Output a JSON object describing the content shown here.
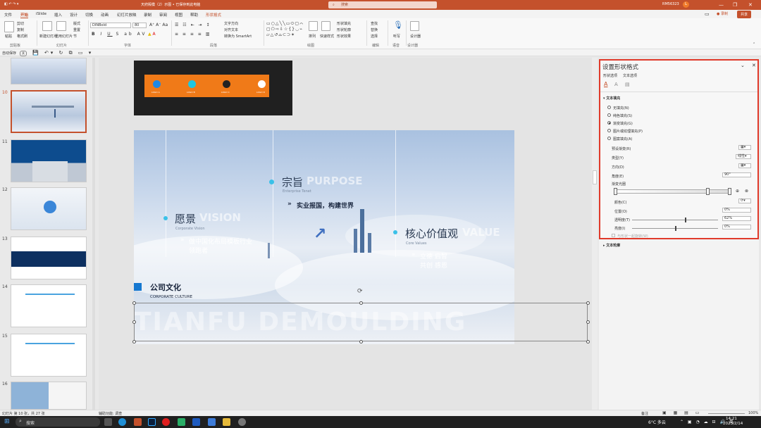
{
  "titlebar": {
    "document_title": "天府殿模（2）示图 • 已保存到此电脑",
    "search_placeholder": "搜索",
    "user_name": "RM56323",
    "avatar_letter": "L",
    "min": "—",
    "restore": "❐",
    "close": "✕",
    "colors": {
      "accent": "#c4512c"
    }
  },
  "menu": {
    "items": [
      "文件",
      "开始",
      "iSlide",
      "插入",
      "设计",
      "切换",
      "动画",
      "幻灯片放映",
      "录制",
      "审阅",
      "视图",
      "帮助",
      "形状格式"
    ],
    "active_index": 1,
    "record_label": "● 录制",
    "share_label": "共享"
  },
  "ribbon": {
    "paste": "粘贴",
    "cut": "剪切",
    "copy": "复制",
    "format_painter": "格式刷",
    "new_slide": "新建幻灯片",
    "reuse_slide": "重用幻灯片",
    "layout": "版式",
    "reset": "重置",
    "section": "节",
    "font_name": "DINBold",
    "font_size": "80",
    "text_direction": "文字方向",
    "align_text": "对齐文本",
    "smartart": "转换为 SmartArt",
    "arrange": "排列",
    "quick_styles": "快速样式",
    "shape_fill": "形状填充",
    "shape_outline": "形状轮廓",
    "shape_effects": "形状效果",
    "find": "查找",
    "replace": "替换",
    "select": "选择",
    "dictate": "听写",
    "designer": "设计器",
    "groups": [
      "剪贴板",
      "幻灯片",
      "字体",
      "段落",
      "绘图",
      "编辑",
      "语音",
      "设计器"
    ]
  },
  "qat": {
    "autosave": "自动保存",
    "toggle": "关"
  },
  "thumbnails": [
    {
      "num": "",
      "selected": false
    },
    {
      "num": "10",
      "selected": true
    },
    {
      "num": "11",
      "selected": false
    },
    {
      "num": "12",
      "selected": false
    },
    {
      "num": "13",
      "selected": false
    },
    {
      "num": "14",
      "selected": false
    },
    {
      "num": "15",
      "selected": false
    },
    {
      "num": "16",
      "selected": false
    }
  ],
  "slide": {
    "purpose_cn": "宗旨",
    "purpose_en": "PURPOSE",
    "purpose_sub": "Enterprise Tenet",
    "purpose_text": "实业报国，构建世界",
    "vision_cn": "愿景",
    "vision_en": "VISION",
    "vision_sub": "Corporate Vision",
    "vision_text_1": "做中国化布局模板行业",
    "vision_text_2": "领跑者",
    "value_cn": "核心价值观",
    "value_en": "VALUE",
    "value_sub": "Core Values",
    "value_text_1": "立德 启智",
    "value_text_2": "共创 感恩",
    "culture_cn": "公司文化",
    "culture_en": "CORPORATE CULTURE",
    "watermark": "TIANFU DEMOULDING",
    "top_labels": [
      "LOGO A",
      "LOGO B",
      "LOGO C",
      "LOGO D"
    ],
    "top_dot_colors": [
      "#1e88e5",
      "#1fc7e0",
      "#222222",
      "#ffffff"
    ]
  },
  "panel": {
    "title": "设置形状格式",
    "tab_shape": "形状选项",
    "tab_text": "文本选项",
    "section_fill": "文本填充",
    "fill_options": [
      "无填充(N)",
      "纯色填充(S)",
      "渐变填充(G)",
      "图片或纹理填充(P)",
      "图案填充(A)"
    ],
    "fill_selected": 2,
    "preset": "预设渐变(R)",
    "type": "类型(Y)",
    "type_value": "线性",
    "direction": "方向(D)",
    "angle": "角度(E)",
    "angle_value": "90°",
    "stops": "渐变光圈",
    "color": "颜色(C)",
    "position": "位置(O)",
    "position_value": "0%",
    "transparency": "透明度(T)",
    "transparency_value": "62%",
    "brightness": "亮度(I)",
    "brightness_value": "0%",
    "rotate_with_shape": "与形状一起旋转(W)",
    "section_outline": "文本轮廓"
  },
  "status": {
    "slide_info": "幻灯片 第 10 张，共 27 张",
    "accessibility": "辅助功能: 调查",
    "notes": "备注",
    "zoom": "100%"
  },
  "taskbar": {
    "search": "搜索",
    "weather": "6°C 多云",
    "time": "14:21",
    "date": "2023/2/14"
  }
}
